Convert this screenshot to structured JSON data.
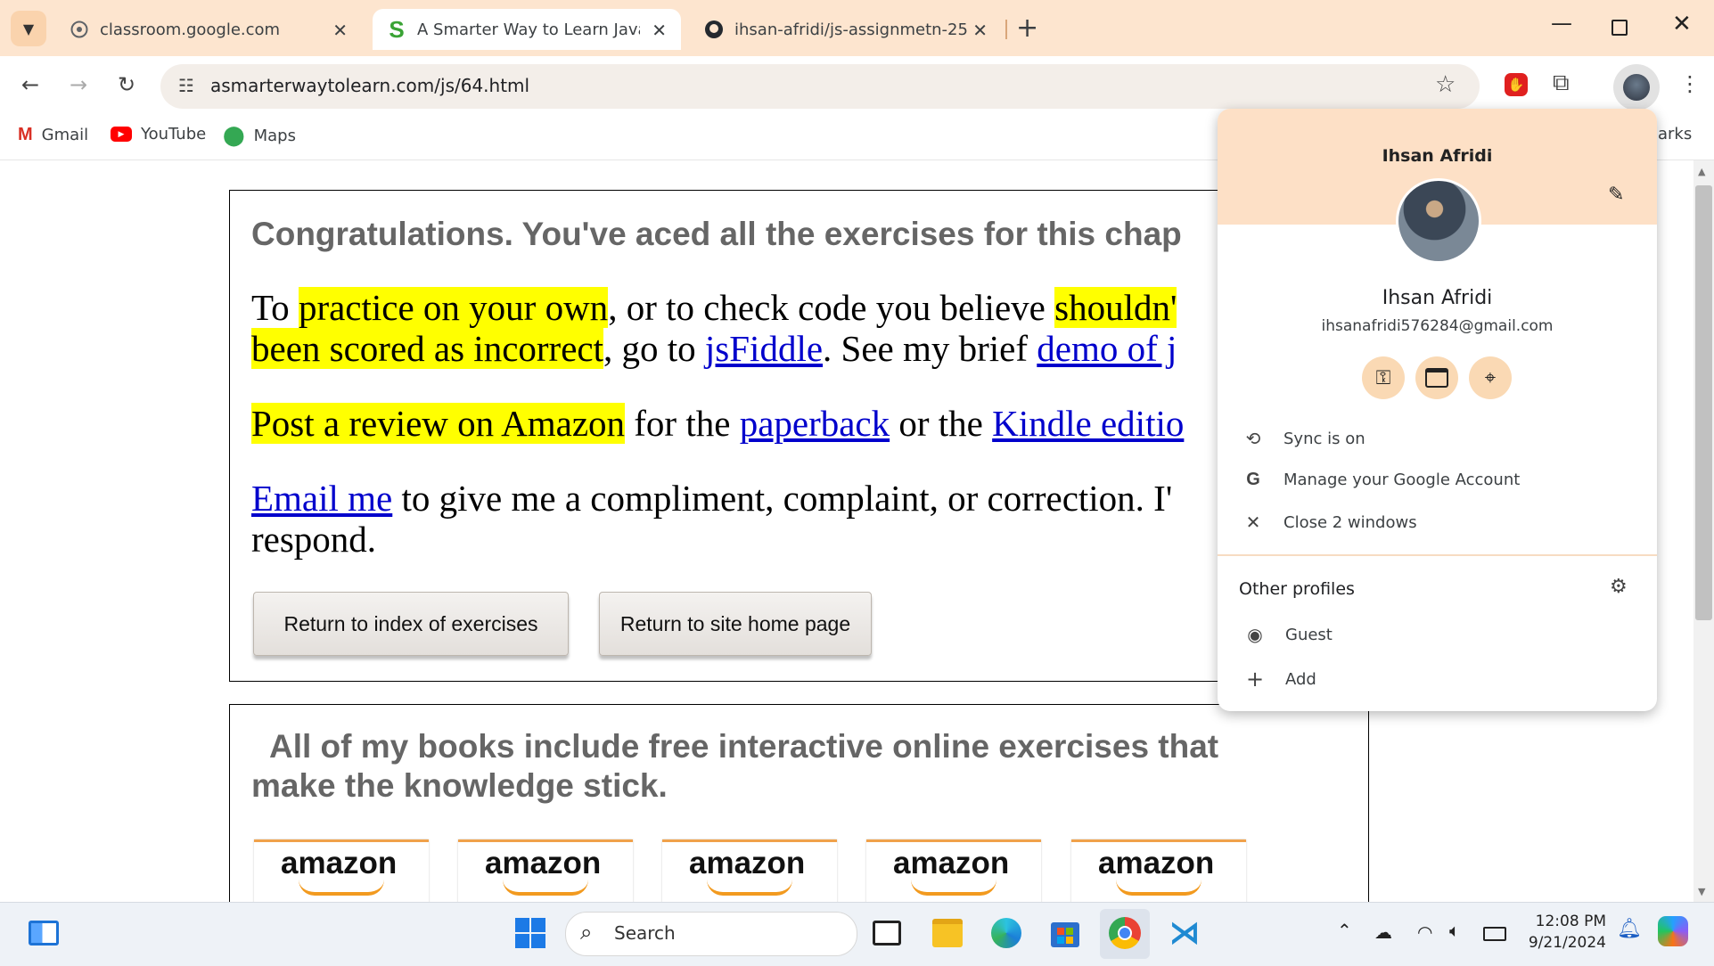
{
  "browser": {
    "tabs": [
      {
        "title": "classroom.google.com",
        "active": false
      },
      {
        "title": "A Smarter Way to Learn JavaScr",
        "active": true
      },
      {
        "title": "ihsan-afridi/js-assignmetn-25",
        "active": false
      }
    ],
    "url": "asmarterwaytolearn.com/js/64.html",
    "bookmarks": [
      "Gmail",
      "YouTube",
      "Maps"
    ],
    "bookmarks_overflow": "arks"
  },
  "page": {
    "congrats": "Congratulations. You've aced all the exercises for this chap",
    "p1": {
      "t1": "To ",
      "hl1": "practice on your own",
      "t2": ", or to check code you believe ",
      "hl2": "shouldn'",
      "hl3": "been scored as incorrect",
      "t3": ", go to ",
      "link1": "jsFiddle",
      "t4": ". See my brief ",
      "link2": "demo of j"
    },
    "p2": {
      "hl": "Post a review on Amazon",
      "t1": " for the ",
      "link1": "paperback",
      "t2": " or the ",
      "link2": "Kindle editio"
    },
    "p3": {
      "link": "Email me",
      "t1": " to give me a compliment, complaint, or correction. I'",
      "t2": "respond."
    },
    "buttons": {
      "index": "Return to index of exercises",
      "home": "Return to site home page"
    },
    "books_heading_1": "All of my books include free interactive online exercises that",
    "books_heading_2": "make the knowledge stick.",
    "amazon_labels": [
      "amazon",
      "amazon",
      "amazon",
      "amazon",
      "amazon"
    ]
  },
  "profile": {
    "name_header": "Ihsan Afridi",
    "name": "Ihsan Afridi",
    "email": "ihsanafridi576284@gmail.com",
    "items": [
      "Sync is on",
      "Manage your Google Account",
      "Close 2 windows"
    ],
    "other_profiles_label": "Other profiles",
    "others": [
      "Guest",
      "Add"
    ]
  },
  "taskbar": {
    "search_placeholder": "Search",
    "time": "12:08 PM",
    "date": "9/21/2024"
  },
  "colors": {
    "tabbar_bg": "#fde5cf",
    "highlight": "#ffff00",
    "link": "#0000cc",
    "popup_header": "#fde0c6"
  }
}
